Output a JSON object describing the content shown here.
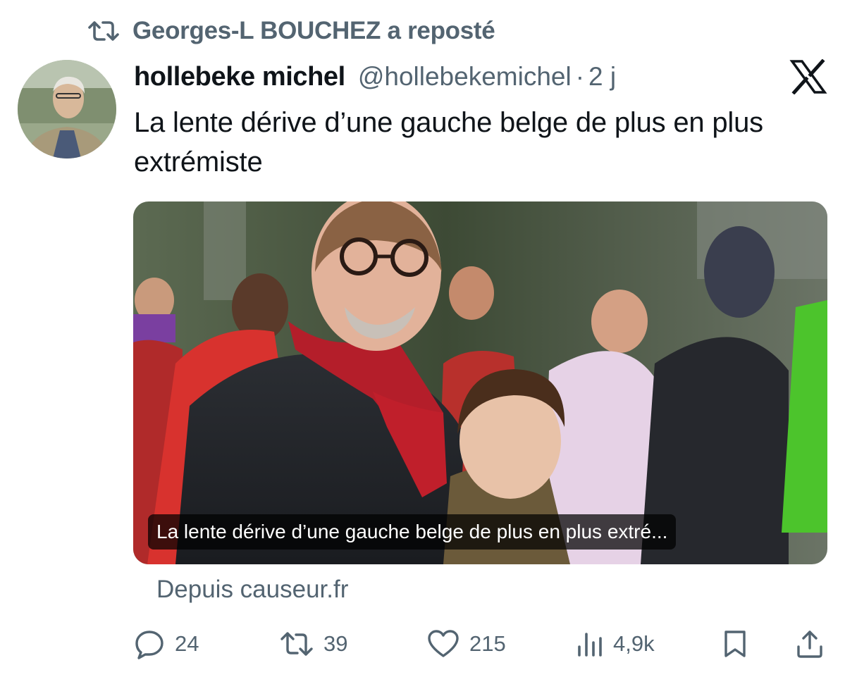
{
  "repost": {
    "text": "Georges-L BOUCHEZ a reposté",
    "icon": "repost-icon"
  },
  "post": {
    "author_name": "hollebeke michel",
    "author_handle": "@hollebekemichel",
    "separator": "·",
    "time": "2 j",
    "platform_icon": "x-logo-icon",
    "text": "La lente dérive d’une gauche belge de plus en plus extrémiste",
    "card": {
      "caption": "La lente dérive d’une gauche belge de plus en plus extré...",
      "source": "Depuis causeur.fr"
    },
    "actions": {
      "replies": "24",
      "reposts": "39",
      "likes": "215",
      "views": "4,9k"
    }
  },
  "colors": {
    "text_primary": "#0f1419",
    "text_secondary": "#536471",
    "background": "#ffffff"
  }
}
